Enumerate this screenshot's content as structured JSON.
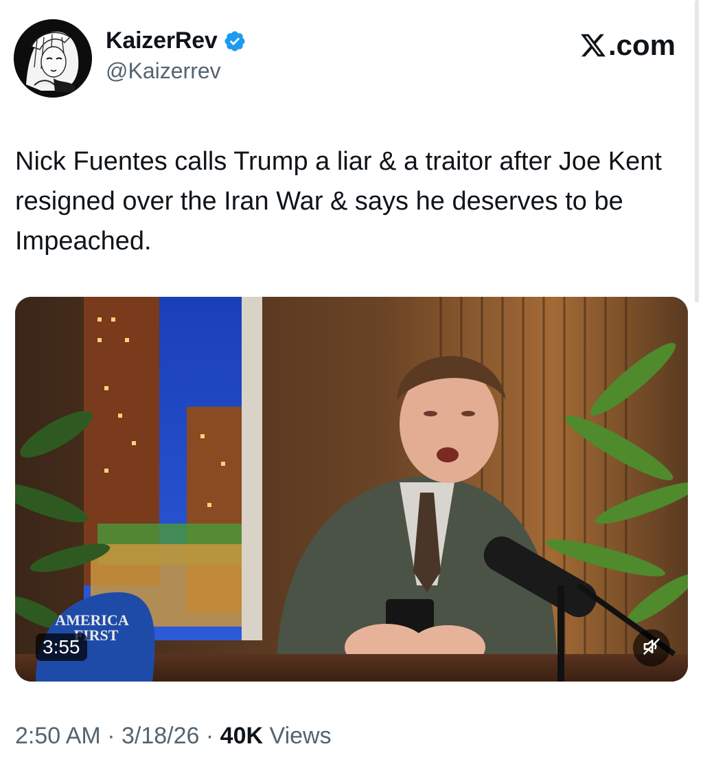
{
  "author": {
    "display_name": "KaizerRev",
    "handle": "@Kaizerrev",
    "verified_icon": "verified-badge-icon"
  },
  "brand": {
    "text": ".com"
  },
  "tweet": {
    "text": "Nick Fuentes calls Trump a liar & a traitor after Joe Kent resigned over the Iran War & says he deserves to be Impeached."
  },
  "media": {
    "duration": "3:55",
    "hat_text_line1": "AMERICA",
    "hat_text_line2": "FIRST",
    "mute_icon": "muted-speaker-icon"
  },
  "meta": {
    "time": "2:50 AM",
    "separator": "·",
    "date": "3/18/26",
    "views_count": "40K",
    "views_label": "Views"
  },
  "colors": {
    "verified": "#1d9bf0",
    "secondary_text": "#536471",
    "primary_text": "#0f1419"
  }
}
